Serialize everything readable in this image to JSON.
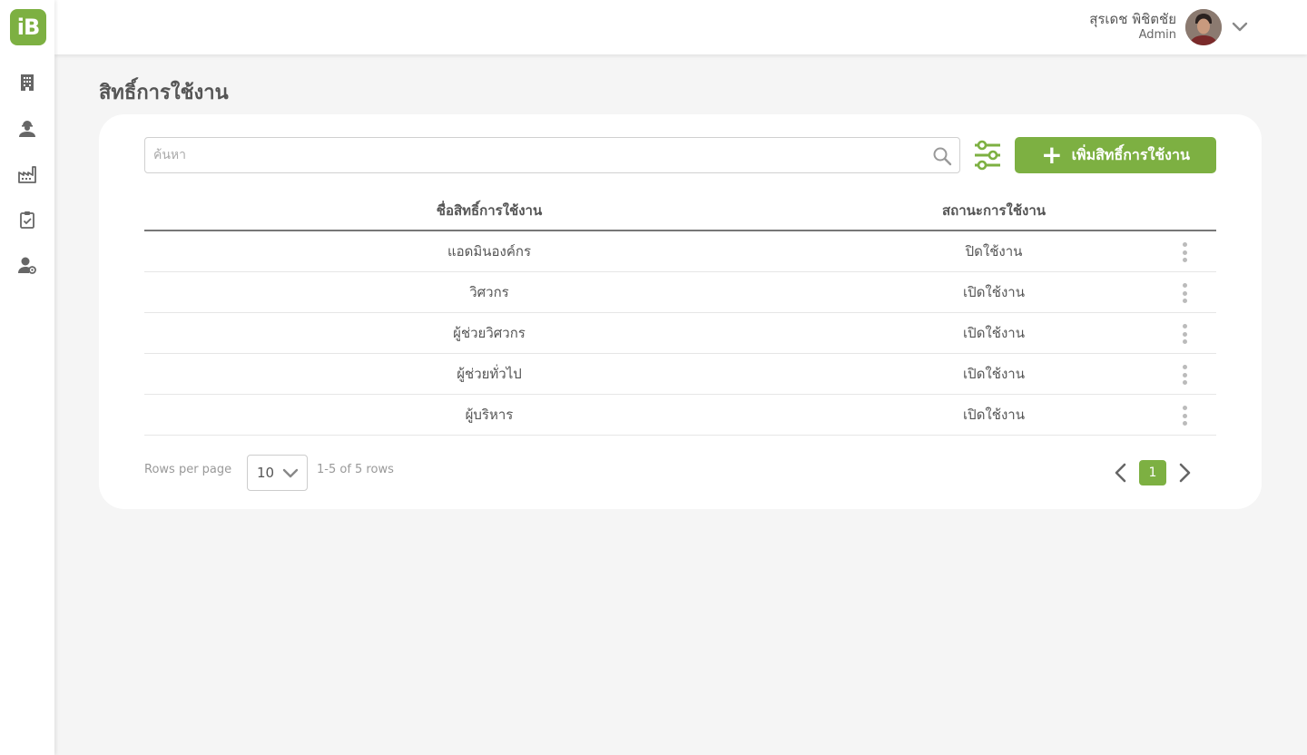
{
  "app": {
    "logo_text": "iB",
    "brand_color": "#7db042"
  },
  "sidebar": {
    "items": [
      {
        "icon": "building-icon"
      },
      {
        "icon": "worker-icon"
      },
      {
        "icon": "factory-icon"
      },
      {
        "icon": "clipboard-check-icon"
      },
      {
        "icon": "user-settings-icon"
      }
    ]
  },
  "header": {
    "user_name": "สุรเดช พิชิตชัย",
    "user_role": "Admin"
  },
  "page": {
    "title": "สิทธิ์การใช้งาน"
  },
  "toolbar": {
    "search_placeholder": "ค้นหา",
    "add_label": "เพิ่มสิทธิ์การใช้งาน"
  },
  "table": {
    "columns": [
      "ชื่อสิทธิ์การใช้งาน",
      "สถานะการใช้งาน"
    ],
    "rows": [
      {
        "name": "แอดมินองค์กร",
        "status": "ปิดใช้งาน"
      },
      {
        "name": "วิศวกร",
        "status": "เปิดใช้งาน"
      },
      {
        "name": "ผู้ช่วยวิศวกร",
        "status": "เปิดใช้งาน"
      },
      {
        "name": "ผู้ช่วยทั่วไป",
        "status": "เปิดใช้งาน"
      },
      {
        "name": "ผู้บริหาร",
        "status": "เปิดใช้งาน"
      }
    ]
  },
  "pagination": {
    "rows_per_page_label": "Rows per page",
    "rows_per_page_value": "10",
    "range_text": "1-5 of 5 rows",
    "current_page": "1"
  }
}
